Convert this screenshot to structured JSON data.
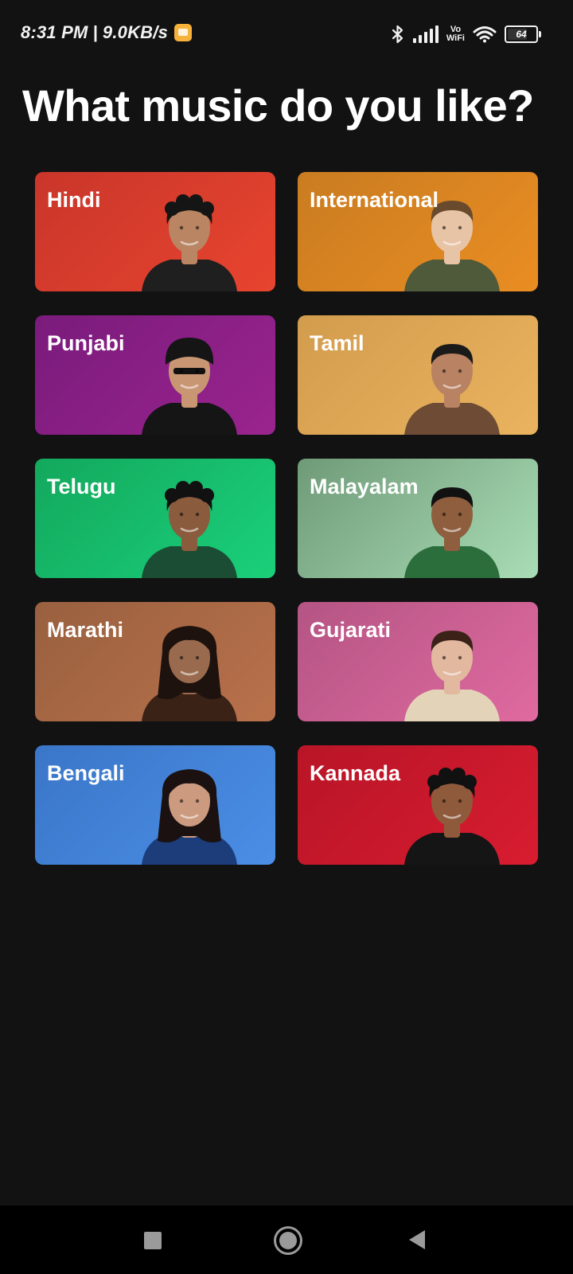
{
  "status_bar": {
    "time": "8:31 PM",
    "separator": "|",
    "network_speed": "9.0KB/s",
    "vowifi_top": "Vo",
    "vowifi_bottom": "WiFi",
    "battery_level": "64",
    "icons": [
      "message-notification-icon",
      "bluetooth-icon",
      "signal-icon",
      "vowifi-icon",
      "wifi-icon",
      "battery-icon"
    ]
  },
  "title": "What music do you like?",
  "languages": [
    {
      "label": "Hindi",
      "color_start": "#c9362a",
      "color_end": "#e8442f",
      "skin": "#b98563",
      "hair": "#151515",
      "shirt": "#1f1f1f",
      "hair_style": "curly"
    },
    {
      "label": "International",
      "color_start": "#c97c21",
      "color_end": "#ea8d22",
      "skin": "#e8c4a6",
      "hair": "#6a4a2c",
      "shirt": "#4f5a3a",
      "hair_style": "short"
    },
    {
      "label": "Punjabi",
      "color_start": "#7a1b7c",
      "color_end": "#9a248e",
      "skin": "#c99674",
      "hair": "#151515",
      "shirt": "#151515",
      "hair_style": "turban"
    },
    {
      "label": "Tamil",
      "color_start": "#d29c4d",
      "color_end": "#e9b35f",
      "skin": "#b98262",
      "hair": "#1a1a1a",
      "shirt": "#6d4b35",
      "hair_style": "short"
    },
    {
      "label": "Telugu",
      "color_start": "#13a85d",
      "color_end": "#1ad07a",
      "skin": "#8a5b3d",
      "hair": "#111111",
      "shirt": "#1a4d33",
      "hair_style": "curly"
    },
    {
      "label": "Malayalam",
      "color_start": "#6f9a78",
      "color_end": "#a9ddb5",
      "skin": "#8e5e3e",
      "hair": "#111111",
      "shirt": "#2b6d3b",
      "hair_style": "short"
    },
    {
      "label": "Marathi",
      "color_start": "#99603f",
      "color_end": "#b9714b",
      "skin": "#9a6a4e",
      "hair": "#1d120d",
      "shirt": "#3a2217",
      "hair_style": "long"
    },
    {
      "label": "Gujarati",
      "color_start": "#b45584",
      "color_end": "#e06aa0",
      "skin": "#e2b89e",
      "hair": "#3b2218",
      "shirt": "#e3d3b8",
      "hair_style": "short"
    },
    {
      "label": "Bengali",
      "color_start": "#3a76c8",
      "color_end": "#4b8ee6",
      "skin": "#cc9a7e",
      "hair": "#1a1110",
      "shirt": "#1c3c7a",
      "hair_style": "long"
    },
    {
      "label": "Kannada",
      "color_start": "#b81527",
      "color_end": "#d81c30",
      "skin": "#8f5a3c",
      "hair": "#111111",
      "shirt": "#151515",
      "hair_style": "curly"
    }
  ],
  "nav_bar": {
    "icons": [
      "recents-icon",
      "home-icon",
      "back-icon"
    ]
  }
}
